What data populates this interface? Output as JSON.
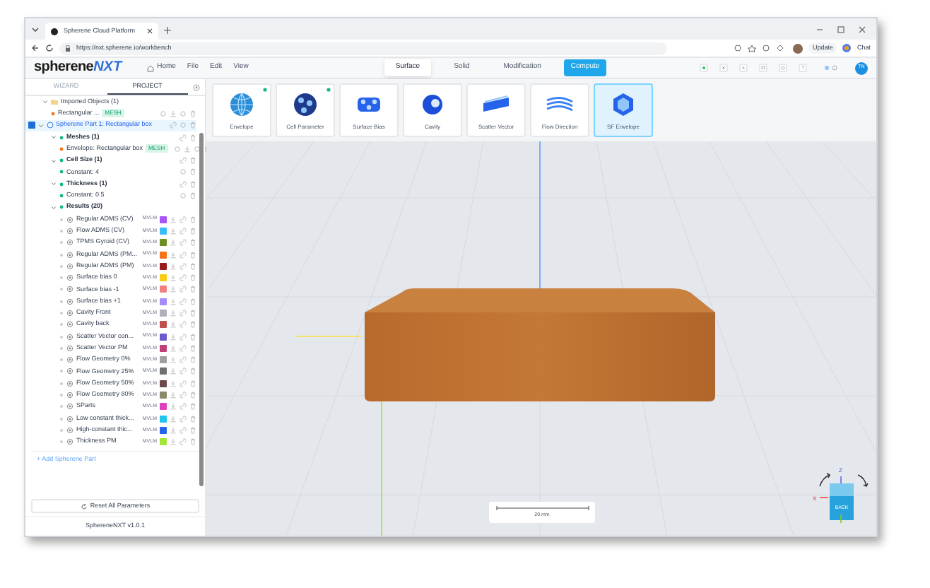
{
  "browser": {
    "tab_title": "Spherene Cloud Platform",
    "url": "https://nxt.spherene.io/workbench",
    "update_label": "Update",
    "chat_label": "Chat"
  },
  "header": {
    "logo_text": "spherene",
    "logo_accent": "NXT",
    "menu": [
      "Home",
      "File",
      "Edit",
      "View"
    ],
    "mode_tabs": [
      {
        "label": "Surface",
        "selected": true
      },
      {
        "label": "Solid",
        "selected": false
      },
      {
        "label": "Modification",
        "selected": false
      }
    ],
    "compute_label": "Compute",
    "avatar_initials": "TN"
  },
  "sidebar": {
    "tabs": [
      {
        "label": "WIZARD",
        "selected": false
      },
      {
        "label": "PROJECT",
        "selected": true
      }
    ],
    "tree": [
      {
        "kind": "folder",
        "label": "Imported Objects (1)",
        "expanded": true,
        "children": [
          {
            "kind": "mesh",
            "label": "Rectangular ...",
            "badge": "MESH"
          }
        ]
      },
      {
        "kind": "part",
        "label": "Spherene Part 1: Rectangular box",
        "checked": true,
        "children": [
          {
            "kind": "section",
            "label": "Meshes (1)",
            "expanded": true,
            "children": [
              {
                "kind": "mesh",
                "label": "Envelope: Rectangular box",
                "badge": "MESH"
              }
            ]
          },
          {
            "kind": "section",
            "label": "Cell Size (1)",
            "expanded": true,
            "children": [
              {
                "kind": "value",
                "label": "Constant: 4"
              }
            ]
          },
          {
            "kind": "section",
            "label": "Thickness (1)",
            "expanded": true,
            "children": [
              {
                "kind": "value",
                "label": "Constant: 0.5"
              }
            ]
          },
          {
            "kind": "section",
            "label": "Results (20)",
            "expanded": true,
            "children": [
              {
                "kind": "result",
                "label": "Regular ADMS (CV)",
                "badge": "MVLM",
                "color": "#a855f7"
              },
              {
                "kind": "result",
                "label": "Flow ADMS (CV)",
                "badge": "MVLM",
                "color": "#38bdf8"
              },
              {
                "kind": "result",
                "label": "TPMS Gyroid (CV)",
                "badge": "MVLM",
                "color": "#6b8e23"
              },
              {
                "kind": "result",
                "label": "Regular ADMS (PM...",
                "badge": "MVLM",
                "color": "#f97316"
              },
              {
                "kind": "result",
                "label": "Regular ADMS (PM)",
                "badge": "MVLM",
                "color": "#991b1b"
              },
              {
                "kind": "result",
                "label": "Surface bias 0",
                "badge": "MVLM",
                "color": "#facc15"
              },
              {
                "kind": "result",
                "label": "Surface bias -1",
                "badge": "MVLM",
                "color": "#f08080"
              },
              {
                "kind": "result",
                "label": "Surface bias +1",
                "badge": "MVLM",
                "color": "#a78bfa"
              },
              {
                "kind": "result",
                "label": "Cavity Front",
                "badge": "MVLM",
                "color": "#b0b0b8"
              },
              {
                "kind": "result",
                "label": "Cavity back",
                "badge": "MVLM",
                "color": "#c0504d"
              },
              {
                "kind": "result",
                "label": "Scatter Vector con...",
                "badge": "MVLM",
                "color": "#6a5acd"
              },
              {
                "kind": "result",
                "label": "Scatter Vector PM",
                "badge": "MVLM",
                "color": "#c0407a"
              },
              {
                "kind": "result",
                "label": "Flow Geometry 0%",
                "badge": "MVLM",
                "color": "#a0a0a0"
              },
              {
                "kind": "result",
                "label": "Flow Geometry 25%",
                "badge": "MVLM",
                "color": "#707070"
              },
              {
                "kind": "result",
                "label": "Flow Geometry 50%",
                "badge": "MVLM",
                "color": "#6b4a4a"
              },
              {
                "kind": "result",
                "label": "Flow Geometry 80%",
                "badge": "MVLM",
                "color": "#8a8a6a"
              },
              {
                "kind": "result",
                "label": "SParts",
                "badge": "MVLM",
                "color": "#e040c0"
              },
              {
                "kind": "result",
                "label": "Low constant thick...",
                "badge": "MVLM",
                "color": "#22c3ee"
              },
              {
                "kind": "result",
                "label": "High-constant thic...",
                "badge": "MVLM",
                "color": "#2563eb"
              },
              {
                "kind": "result",
                "label": "Thickness PM",
                "badge": "MVLM",
                "color": "#a3e635"
              }
            ]
          }
        ]
      }
    ],
    "add_part": "+ Add Spherene Part",
    "reset": "Reset All Parameters",
    "version": "SphereneNXT v1.0.1"
  },
  "tools": [
    {
      "label": "Envelope",
      "selected": false,
      "dot": true
    },
    {
      "label": "Cell Parameter",
      "selected": false,
      "dot": true
    },
    {
      "label": "Surface Bias",
      "selected": false,
      "dot": false
    },
    {
      "label": "Cavity",
      "selected": false,
      "dot": false
    },
    {
      "label": "Scatter Vector",
      "selected": false,
      "dot": false
    },
    {
      "label": "Flow Direction",
      "selected": false,
      "dot": false
    },
    {
      "label": "SF Envelope",
      "selected": true,
      "dot": false
    }
  ],
  "viewport": {
    "scale_label": "20 mm",
    "gizmo": {
      "z_label": "Z",
      "x_label": "X",
      "front_label": "BACK"
    }
  }
}
